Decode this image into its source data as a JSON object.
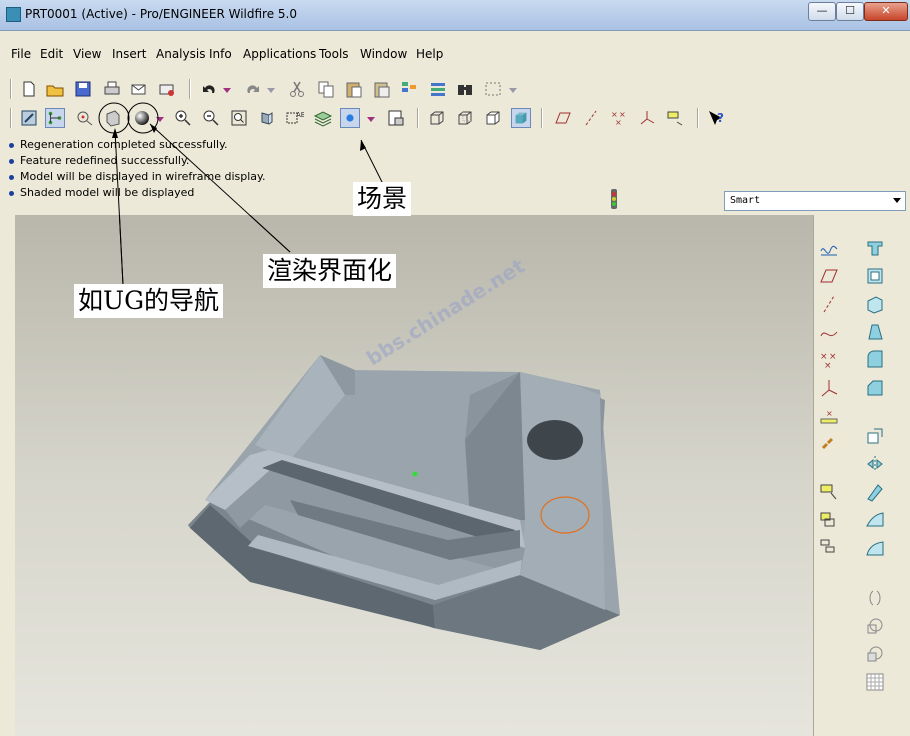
{
  "window": {
    "title": "PRT0001 (Active) - Pro/ENGINEER Wildfire 5.0",
    "min_label": "—",
    "max_label": "☐",
    "close_label": "✕"
  },
  "menu": [
    "File",
    "Edit",
    "View",
    "Insert",
    "Analysis",
    "Info",
    "Applications",
    "Tools",
    "Window",
    "Help"
  ],
  "toolbar1": [
    "new-icon",
    "open-icon",
    "save-icon",
    "print-icon",
    "send-mail-icon",
    "mail-attach-icon",
    "undo-icon",
    "redo-icon",
    "cut-icon",
    "copy-icon",
    "paste-icon",
    "paste-special-icon",
    "regenerate-icon",
    "regen-manager-icon",
    "find-icon",
    "select-box-icon"
  ],
  "toolbar2": [
    "repaint-icon",
    "navigator-icon",
    "spin-center-icon",
    "orient-mode-icon",
    "render-sphere-icon",
    "zoom-in-icon",
    "zoom-out-icon",
    "refit-icon",
    "reorient-icon",
    "saved-views-icon",
    "layers-icon",
    "scene-icon",
    "view-manager-icon",
    "wireframe-icon",
    "hidden-line-icon",
    "no-hidden-icon",
    "shading-icon",
    "datum-planes-icon",
    "datum-axes-icon",
    "datum-points-icon",
    "datum-csys-icon",
    "annotation-icon",
    "context-help-icon"
  ],
  "messages": [
    "Regeneration completed successfully.",
    "Feature redefined successfully.",
    "Model will be displayed in wireframe display.",
    "Shaded model will be displayed"
  ],
  "filter": {
    "value": "Smart"
  },
  "annotations": {
    "scene": "场景",
    "render": "渲染界面化",
    "navigator": "如UG的导航"
  },
  "watermark": "bbs.chinade.net",
  "colors": {
    "model": "#8f9aa3",
    "background_top": "#b9b7ab",
    "background_bottom": "#e6e5dd",
    "hole_circle": "#e07020"
  }
}
